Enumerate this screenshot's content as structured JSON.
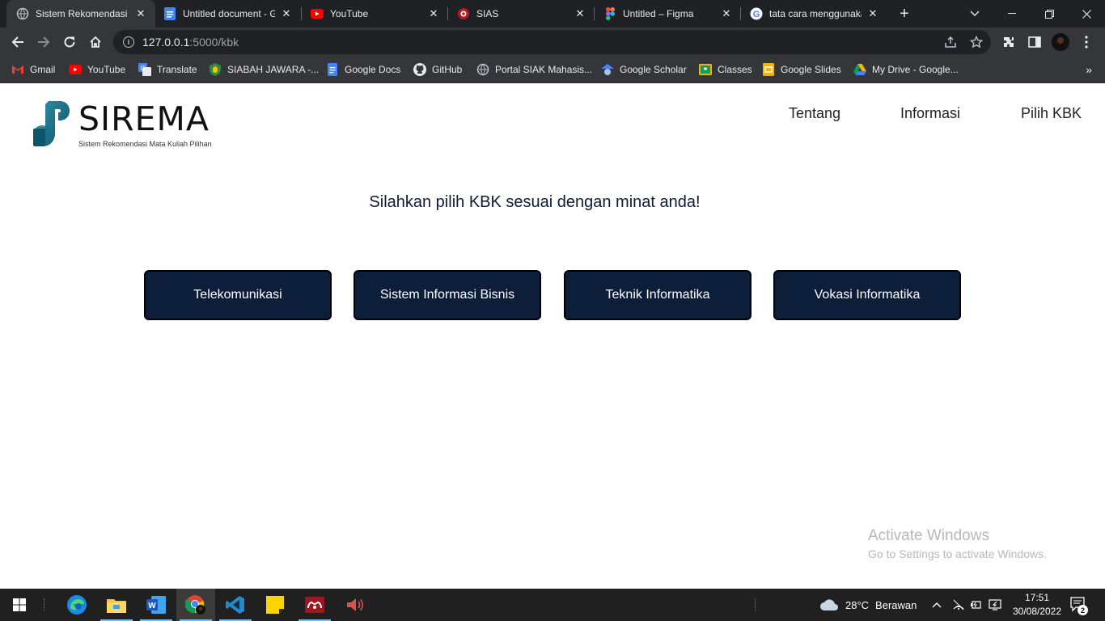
{
  "browser": {
    "tabs": [
      {
        "title": "Sistem Rekomendasi M",
        "icon": "globe-icon",
        "active": true
      },
      {
        "title": "Untitled document - G",
        "icon": "google-docs-icon"
      },
      {
        "title": "YouTube",
        "icon": "youtube-icon"
      },
      {
        "title": "SIAS",
        "icon": "sias-icon"
      },
      {
        "title": "Untitled – Figma",
        "icon": "figma-icon"
      },
      {
        "title": "tata cara menggunaka",
        "icon": "google-icon"
      }
    ],
    "url_host": "127.0.0.1",
    "url_path": ":5000/kbk",
    "bookmarks": [
      {
        "label": "Gmail",
        "icon": "gmail-icon"
      },
      {
        "label": "YouTube",
        "icon": "youtube-icon"
      },
      {
        "label": "Translate",
        "icon": "translate-icon"
      },
      {
        "label": "SIABAH JAWARA -...",
        "icon": "shield-icon"
      },
      {
        "label": "Google Docs",
        "icon": "google-docs-icon"
      },
      {
        "label": "GitHub",
        "icon": "github-icon"
      },
      {
        "label": "Portal SIAK Mahasis...",
        "icon": "globe-icon"
      },
      {
        "label": "Google Scholar",
        "icon": "scholar-icon"
      },
      {
        "label": "Classes",
        "icon": "classroom-icon"
      },
      {
        "label": "Google Slides",
        "icon": "slides-icon"
      },
      {
        "label": "My Drive - Google...",
        "icon": "drive-icon"
      }
    ]
  },
  "site": {
    "logo_text": "SIREMA",
    "logo_subtitle": "Sistem Rekomendasi Mata Kuliah Pilihan",
    "nav": [
      "Tentang",
      "Informasi",
      "Pilih KBK"
    ],
    "heading": "Silahkan pilih KBK sesuai dengan minat anda!",
    "kbk_options": [
      "Telekomunikasi",
      "Sistem Informasi Bisnis",
      "Teknik Informatika",
      "Vokasi Informatika"
    ],
    "brand_color": "#0c1e3a"
  },
  "watermark": {
    "title": "Activate Windows",
    "subtitle": "Go to Settings to activate Windows."
  },
  "taskbar": {
    "apps": [
      "start-icon",
      "edge-icon",
      "file-explorer-icon",
      "word-icon",
      "chrome-icon",
      "vscode-icon",
      "sticky-notes-icon",
      "mendeley-icon",
      "audio-app-icon"
    ],
    "weather_temp": "28°C",
    "weather_text": "Berawan",
    "time": "17:51",
    "date": "30/08/2022",
    "notification_count": "2"
  }
}
